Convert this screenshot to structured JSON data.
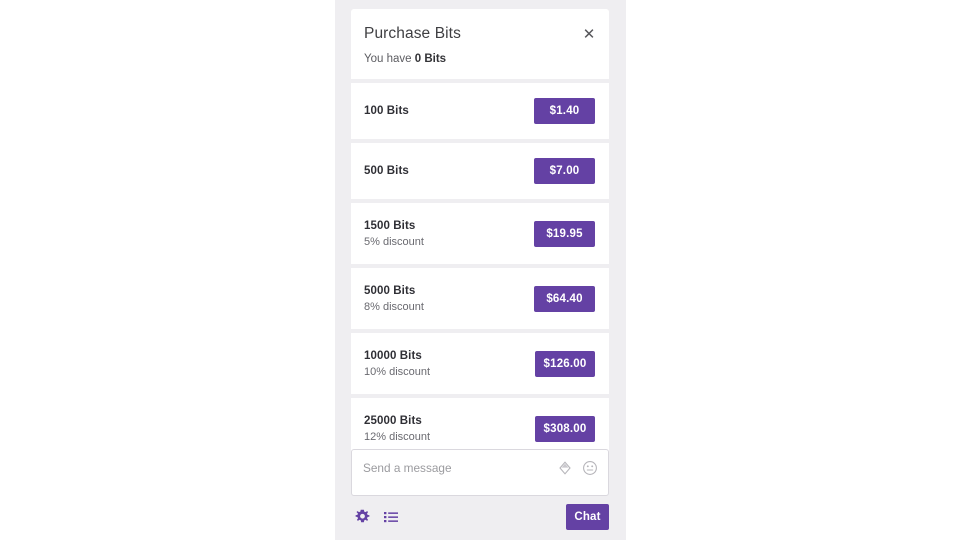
{
  "panel": {
    "title": "Purchase Bits",
    "balance_prefix": "You have ",
    "balance_amount": "0 Bits",
    "close_icon": "close-icon",
    "close_glyph": "✕",
    "accent_color": "#6441a4",
    "background_color": "#efeef1"
  },
  "tiers": [
    {
      "name": "100 Bits",
      "discount": "",
      "price": "$1.40"
    },
    {
      "name": "500 Bits",
      "discount": "",
      "price": "$7.00"
    },
    {
      "name": "1500 Bits",
      "discount": "5% discount",
      "price": "$19.95"
    },
    {
      "name": "5000 Bits",
      "discount": "8% discount",
      "price": "$64.40"
    },
    {
      "name": "10000 Bits",
      "discount": "10% discount",
      "price": "$126.00"
    },
    {
      "name": "25000 Bits",
      "discount": "12% discount",
      "price": "$308.00"
    }
  ],
  "composer": {
    "placeholder": "Send a message",
    "bits_icon": "bits-diamond-icon",
    "emote_icon": "smiley-emote-icon"
  },
  "footer": {
    "settings_icon": "gear-icon",
    "user_list_icon": "list-icon",
    "chat_label": "Chat"
  }
}
